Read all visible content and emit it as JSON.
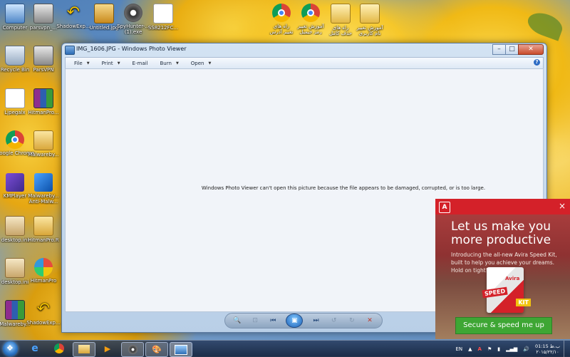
{
  "desktop": {
    "icons": [
      {
        "label": "Computer",
        "icon": "computer-icon"
      },
      {
        "label": "parsvpn_...",
        "icon": "vpn-icon"
      },
      {
        "label": "ShadowExp...",
        "icon": "shortcut-arrow-icon"
      },
      {
        "label": "Untitled.jpg",
        "icon": "image-file-icon"
      },
      {
        "label": "SpyHunter-... (1).exe",
        "icon": "spyhunter-icon"
      },
      {
        "label": "SS8212FC...",
        "icon": "document-icon"
      },
      {
        "label": "ﺭﺍﻩ ﻫﺎی\nﺗﻐﯿﯿﺮ ﺁﺩﺭﺱ",
        "icon": "chrome-icon"
      },
      {
        "label": "ﺁﻣﻮﺯﺵ ﺗﻐﯿﯿﺮ\nﺭﻣﺰ ﺟﯿﻤﯿﻞ",
        "icon": "chrome-icon"
      },
      {
        "label": "ﺭﺍﻩ ﻫﺎی\nﺣﺬﻑ ﮐﺎﻣﻞ",
        "icon": "folder-file-icon"
      },
      {
        "label": "ﺁﻣﻮﺯﺵ ﺗﻐﯿﯿﺮ\nﻧﺎﻡ ﮐﺎﺭﺑﺮی",
        "icon": "folder-file-icon"
      },
      {
        "label": "Recycle Bin",
        "icon": "recycle-bin-icon"
      },
      {
        "label": "ParsVPN",
        "icon": "vpn-icon"
      },
      {
        "label": "Ljpegalx",
        "icon": "document-icon"
      },
      {
        "label": "HitmanPro...",
        "icon": "winrar-icon"
      },
      {
        "label": "Google Chrome",
        "icon": "chrome-icon"
      },
      {
        "label": "Malwareby...",
        "icon": "folder-icon"
      },
      {
        "label": "KMPlayer",
        "icon": "kmplayer-icon"
      },
      {
        "label": "Malwareby... Anti-Malw...",
        "icon": "malwarebytes-icon"
      },
      {
        "label": "desktop.ini",
        "icon": "settings-file-icon"
      },
      {
        "label": "HitmanPro.R",
        "icon": "folder-icon"
      },
      {
        "label": "desktop.ini",
        "icon": "settings-file-icon"
      },
      {
        "label": "HitmanPro",
        "icon": "hitmanpro-icon"
      },
      {
        "label": "Malwareby...",
        "icon": "winrar-icon"
      },
      {
        "label": "ShadowExp...",
        "icon": "shortcut-arrow-icon"
      }
    ]
  },
  "window": {
    "title": "IMG_1606.JPG - Windows Photo Viewer",
    "menus": [
      "File",
      "Print",
      "E-mail",
      "Burn",
      "Open"
    ],
    "help": "?",
    "message": "Windows Photo Viewer can't open this picture because the file appears to be damaged, corrupted, or is too large.",
    "controls": {
      "zoom": "🔍",
      "actual_size": "⊡",
      "previous": "⏮",
      "slideshow": "▣",
      "next": "⏭",
      "rotate_ccw": "↺",
      "rotate_cw": "↻",
      "delete": "✕"
    }
  },
  "avira": {
    "logo": "A",
    "close": "×",
    "headline_line1": "Let us make you",
    "headline_line2": "more productive",
    "body": "Introducing the all-new Avira Speed Kit, built to help you achieve your dreams. Hold on tight!",
    "box_brand": "Avira",
    "box_speed": "SPEED",
    "box_kit": "KIT",
    "cta": "Secure & speed me up",
    "accent": "#d42129",
    "cta_color": "#3ea634"
  },
  "taskbar": {
    "pinned": [
      "ie-icon",
      "chrome-icon",
      "explorer-icon",
      "media-player-icon",
      "spyhunter-icon",
      "paint-icon",
      "photo-viewer-icon"
    ],
    "tray": {
      "lang": "EN",
      "time": "01:15 ب.ظ",
      "date": "۲۰۱۵/۲۲/۱۰"
    }
  }
}
